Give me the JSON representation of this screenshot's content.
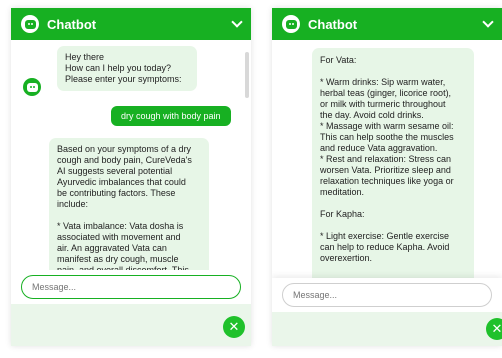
{
  "left": {
    "title": "Chatbot",
    "greeting": [
      "Hey there",
      "How can I help you today?",
      "Please enter your symptoms:"
    ],
    "user_message": "dry cough with body pain",
    "reply": [
      "Based on your symptoms of a dry",
      "cough and body pain, CureVeda's",
      "AI suggests several potential",
      "Ayurvedic imbalances that could",
      "be contributing factors. These",
      "include:",
      "",
      "* Vata imbalance: Vata dosha is",
      "associated with movement and",
      "air. An aggravated Vata can",
      "manifest as dry cough, muscle",
      "pain, and overall discomfort. This"
    ],
    "input_placeholder": "Message..."
  },
  "right": {
    "title": "Chatbot",
    "reply": [
      "For Vata:",
      "",
      "* Warm drinks: Sip warm water,",
      "herbal teas (ginger, licorice root),",
      "or milk with turmeric throughout",
      "the day. Avoid cold drinks.",
      "* Massage with warm sesame oil:",
      "This can help soothe the muscles",
      "and reduce Vata aggravation.",
      "* Rest and relaxation: Stress can",
      "worsen Vata. Prioritize sleep and",
      "relaxation techniques like yoga or",
      "meditation.",
      "",
      "For Kapha:",
      "",
      "* Light exercise: Gentle exercise",
      "can help to reduce Kapha. Avoid",
      "overexertion."
    ],
    "input_placeholder": "Message..."
  },
  "colors": {
    "brand": "#17b022",
    "bubble": "#e7f6e7"
  },
  "icons": {
    "bot": "robot-icon",
    "collapse": "chevron-down-icon",
    "close": "close-icon"
  }
}
